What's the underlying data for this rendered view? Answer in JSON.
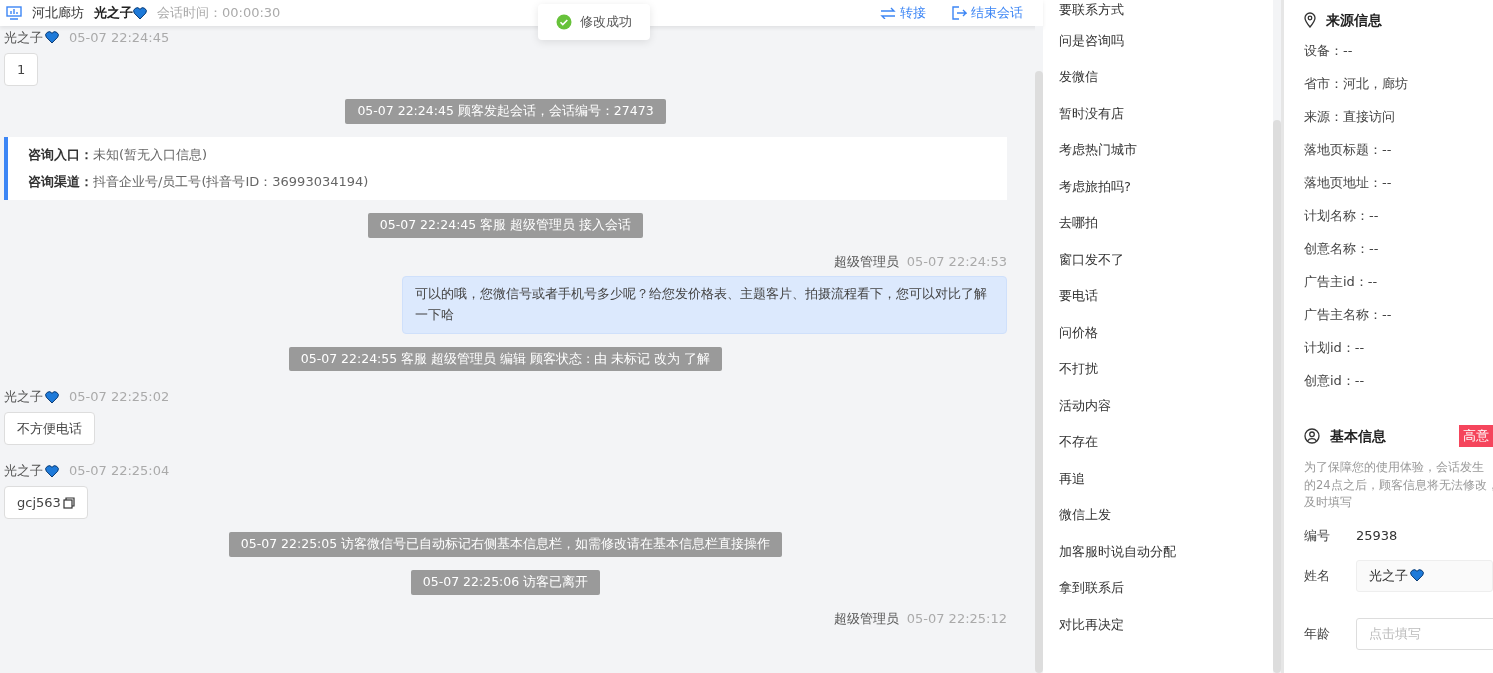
{
  "header": {
    "location": "河北廊坊",
    "customer": "光之子",
    "customer_heart": true,
    "duration": "会话时间：00:00:30",
    "actions": [
      {
        "label": "转接",
        "kind": "transfer"
      },
      {
        "label": "结束会话",
        "kind": "exit"
      }
    ]
  },
  "toast": {
    "text": "修改成功"
  },
  "messages": [
    {
      "kind": "customer",
      "name": "光之子",
      "heart": true,
      "time": "05-07 22:24:45",
      "text": "1"
    },
    {
      "kind": "system",
      "text": "05-07 22:24:45 顾客发起会话，会话编号：27473"
    },
    {
      "kind": "info",
      "rows": [
        {
          "label": "咨询入口：",
          "value": "未知(暂无入口信息)"
        },
        {
          "label": "咨询渠道：",
          "value": "抖音企业号/员工号(抖音号ID：36993034194)"
        }
      ]
    },
    {
      "kind": "system",
      "text": "05-07 22:24:45 客服 超级管理员 接入会话"
    },
    {
      "kind": "agent",
      "name": "超级管理员",
      "time": "05-07 22:24:53",
      "text": "可以的哦，您微信号或者手机号多少呢？给您发价格表、主题客片、拍摄流程看下，您可以对比了解一下哈"
    },
    {
      "kind": "system",
      "text": "05-07 22:24:55 客服 超级管理员 编辑 顾客状态 : 由 未标记 改为 了解"
    },
    {
      "kind": "customer",
      "name": "光之子",
      "heart": true,
      "time": "05-07 22:25:02",
      "text": "不方便电话"
    },
    {
      "kind": "customer",
      "name": "光之子",
      "heart": true,
      "time": "05-07 22:25:04",
      "text": "gcj563",
      "copy": true
    },
    {
      "kind": "system",
      "text": "05-07 22:25:05 访客微信号已自动标记右侧基本信息栏，如需修改请在基本信息栏直接操作"
    },
    {
      "kind": "system",
      "text": "05-07 22:25:06 访客已离开"
    },
    {
      "kind": "agent",
      "name": "超级管理员",
      "time": "05-07 22:25:12"
    }
  ],
  "quick_replies": [
    "要联系方式",
    "问是咨询吗",
    "发微信",
    "暂时没有店",
    "考虑热门城市",
    "考虑旅拍吗?",
    "去哪拍",
    "窗口发不了",
    "要电话",
    "问价格",
    "不打扰",
    "活动内容",
    "不存在",
    "再追",
    "微信上发",
    "加客服时说自动分配",
    "拿到联系后",
    "对比再决定"
  ],
  "source_info": {
    "title": "来源信息",
    "fields": [
      "设备：--",
      "省市：河北，廊坊",
      "来源：直接访问",
      "落地页标题：--",
      "落地页地址：--",
      "计划名称：--",
      "创意名称：--",
      "广告主id：--",
      "广告主名称：--",
      "计划id：--",
      "创意id：--"
    ]
  },
  "basic_info": {
    "title": "基本信息",
    "tag": "高意",
    "notice_lines": [
      "为了保障您的使用体验，会话发生",
      "的24点之后，顾客信息将无法修改，",
      "及时填写"
    ],
    "fields": [
      {
        "kind": "text",
        "label": "编号",
        "value": "25938"
      },
      {
        "kind": "input",
        "label": "姓名",
        "value": "光之子",
        "heart": true
      },
      {
        "kind": "input",
        "label": "年龄",
        "placeholder": "点击填写"
      }
    ]
  }
}
